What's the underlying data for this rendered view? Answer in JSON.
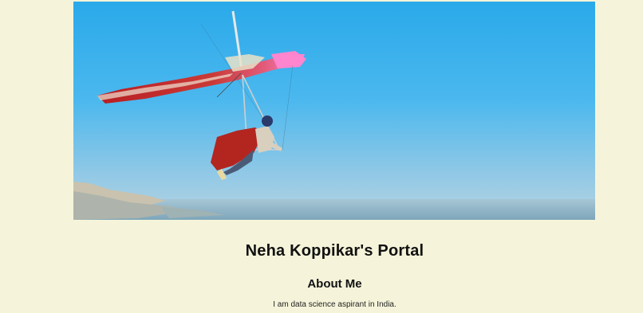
{
  "hero": {
    "image_description": "hang glider flying over a hazy coastline and blue sky",
    "colors": {
      "sky_top": "#2fb1ec",
      "sky_bottom": "#a9d3e8",
      "wing": "#c2232b",
      "wing_tip": "#ff7fd0"
    }
  },
  "site": {
    "title": "Neha Koppikar's Portal"
  },
  "about": {
    "heading": "About Me",
    "text": "I am data science aspirant in India."
  },
  "colors": {
    "page_background": "#f5f4da",
    "text": "#111111"
  }
}
